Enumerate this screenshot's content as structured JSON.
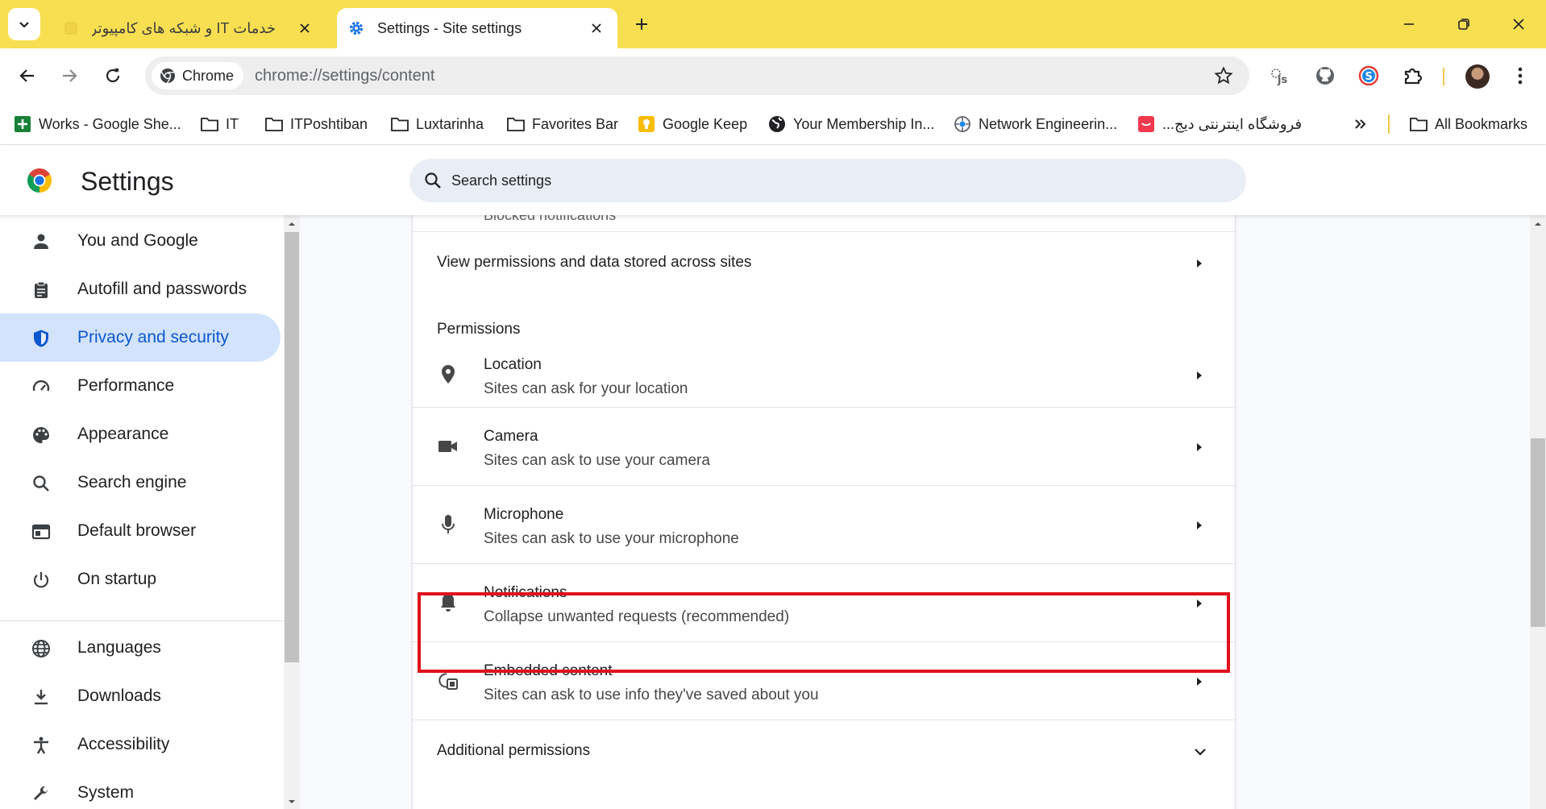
{
  "colors": {
    "tabstrip": "#f8df52",
    "accent": "#0b57d0",
    "active_nav_bg": "#d3e3fd",
    "highlight": "#e0101b"
  },
  "tabs": [
    {
      "title": "خدمات IT و شبکه های کامپیوتری",
      "active": false
    },
    {
      "title": "Settings - Site settings",
      "active": true
    }
  ],
  "toolbar": {
    "chip_label": "Chrome",
    "url": "chrome://settings/content",
    "extensions": [
      "js-icon",
      "github-icon",
      "skype-icon",
      "puzzle-icon"
    ]
  },
  "bookmarks": [
    {
      "label": "Works - Google She...",
      "icon": "sheets-icon"
    },
    {
      "label": "IT",
      "icon": "folder-icon"
    },
    {
      "label": "ITPoshtiban",
      "icon": "folder-icon"
    },
    {
      "label": "Luxtarinha",
      "icon": "folder-icon"
    },
    {
      "label": "Favorites Bar",
      "icon": "folder-icon"
    },
    {
      "label": "Google Keep",
      "icon": "keep-icon"
    },
    {
      "label": "Your Membership In...",
      "icon": "globe-icon"
    },
    {
      "label": "Network Engineerin...",
      "icon": "network-icon"
    },
    {
      "label": "فروشگاه اینترنتی دیج...",
      "icon": "digikala-icon"
    },
    {
      "label": "All Bookmarks",
      "icon": "folder-icon"
    }
  ],
  "header": {
    "title": "Settings",
    "search_placeholder": "Search settings"
  },
  "sidebar": {
    "items": [
      {
        "label": "You and Google",
        "icon": "person-icon"
      },
      {
        "label": "Autofill and passwords",
        "icon": "clipboard-icon"
      },
      {
        "label": "Privacy and security",
        "icon": "shield-icon",
        "active": true
      },
      {
        "label": "Performance",
        "icon": "speedometer-icon"
      },
      {
        "label": "Appearance",
        "icon": "palette-icon"
      },
      {
        "label": "Search engine",
        "icon": "search-icon"
      },
      {
        "label": "Default browser",
        "icon": "browser-icon"
      },
      {
        "label": "On startup",
        "icon": "power-icon"
      },
      {
        "label": "Languages",
        "icon": "globe-icon"
      },
      {
        "label": "Downloads",
        "icon": "download-icon"
      },
      {
        "label": "Accessibility",
        "icon": "accessibility-icon"
      },
      {
        "label": "System",
        "icon": "wrench-icon"
      }
    ]
  },
  "content": {
    "cut_off_text": "Blocked notifications",
    "view_permissions": "View permissions and data stored across sites",
    "permissions_heading": "Permissions",
    "permissions": [
      {
        "title": "Location",
        "subtitle": "Sites can ask for your location",
        "icon": "location-pin-icon"
      },
      {
        "title": "Camera",
        "subtitle": "Sites can ask to use your camera",
        "icon": "camera-icon"
      },
      {
        "title": "Microphone",
        "subtitle": "Sites can ask to use your microphone",
        "icon": "microphone-icon"
      },
      {
        "title": "Notifications",
        "subtitle": "Collapse unwanted requests (recommended)",
        "icon": "bell-icon"
      },
      {
        "title": "Embedded content",
        "subtitle": "Sites can ask to use info they've saved about you",
        "icon": "embedded-content-icon"
      }
    ],
    "additional_permissions": "Additional permissions"
  }
}
